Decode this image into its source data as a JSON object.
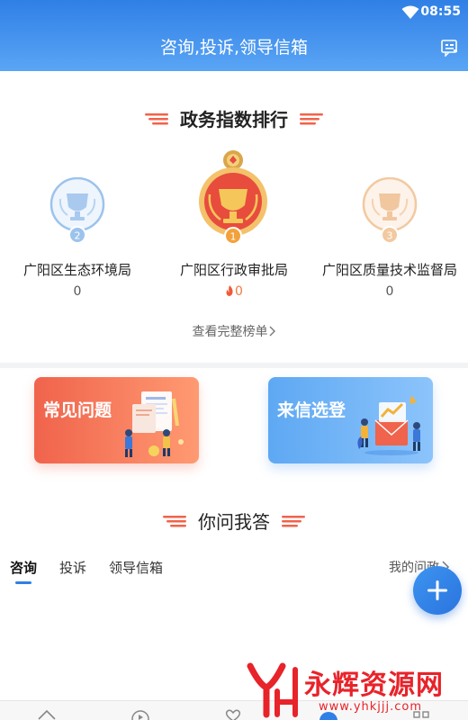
{
  "status_bar": {
    "time": "08:55",
    "wifi_icon": "wifi-icon"
  },
  "header": {
    "title": "咨询,投诉,领导信箱",
    "action_icon": "mailbox-edit-icon"
  },
  "ranking": {
    "title": "政务指数排行",
    "items": [
      {
        "rank": "2",
        "name": "广阳区生态环境局",
        "score": "0",
        "medal_color": "#8fb8e6"
      },
      {
        "rank": "1",
        "name": "广阳区行政审批局",
        "score": "0",
        "medal_color": "#e84c3d",
        "hot": true
      },
      {
        "rank": "3",
        "name": "广阳区质量技术监督局",
        "score": "0",
        "medal_color": "#f2c49a"
      }
    ],
    "view_all": "查看完整榜单"
  },
  "cards": {
    "faq_label": "常见问题",
    "letter_label": "来信选登"
  },
  "qa": {
    "title": "你问我答",
    "tabs": [
      "咨询",
      "投诉",
      "领导信箱"
    ],
    "active_tab": 0,
    "my_questions": "我的问政"
  },
  "fab_icon": "plus-icon",
  "watermark": {
    "text": "永辉资源网",
    "url": "www.yhkjjj.com"
  },
  "colors": {
    "primary": "#2f7fe6",
    "accent_orange": "#f07b3f",
    "faq_card": "#f0634c",
    "letter_card": "#5ea8f3"
  }
}
